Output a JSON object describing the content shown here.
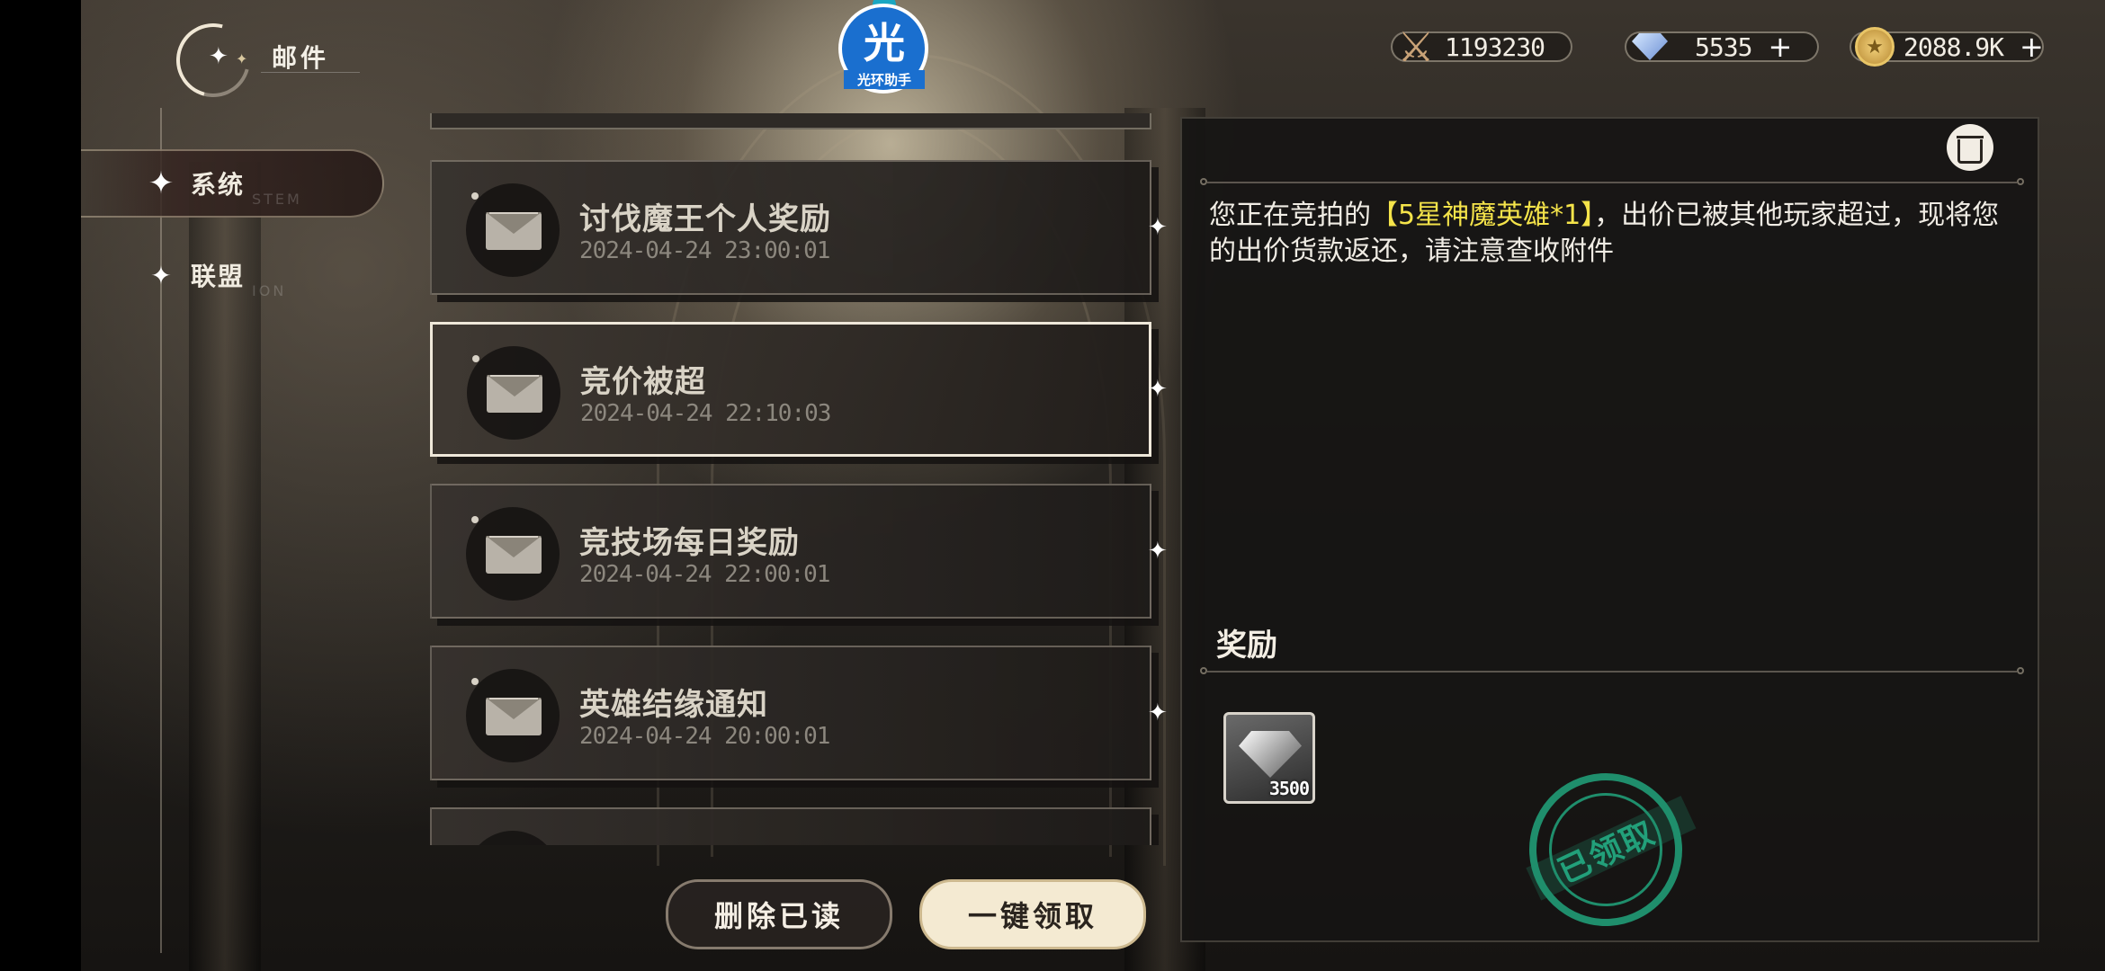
{
  "header": {
    "title": "邮件"
  },
  "badge": {
    "glyph": "光",
    "caption": "光环助手"
  },
  "currencies": [
    {
      "icon": "crossed-swords-icon",
      "value": "1193230",
      "has_plus": false
    },
    {
      "icon": "diamond-icon",
      "value": "5535",
      "has_plus": true
    },
    {
      "icon": "gold-coin-icon",
      "value": "2088.9K",
      "has_plus": true
    }
  ],
  "plus_symbol": "+",
  "sidebar": {
    "items": [
      {
        "label": "系统",
        "ghost": "STEM",
        "active": true
      },
      {
        "label": "联盟",
        "ghost": "ION",
        "active": false
      }
    ]
  },
  "mail_list": [
    {
      "title": "讨伐魔王个人奖励",
      "date": "2024-04-24 23:00:01",
      "selected": false
    },
    {
      "title": "竞价被超",
      "date": "2024-04-24 22:10:03",
      "selected": true
    },
    {
      "title": "竞技场每日奖励",
      "date": "2024-04-24 22:00:01",
      "selected": false
    },
    {
      "title": "英雄结缘通知",
      "date": "2024-04-24 20:00:01",
      "selected": false
    }
  ],
  "buttons": {
    "delete_read": "删除已读",
    "claim_all": "一键领取"
  },
  "detail": {
    "message_prefix": "您正在竞拍的",
    "message_highlight": "【5星神魔英雄*1】",
    "message_suffix": "，出价已被其他玩家超过，现将您的出价货款返还，请注意查收附件",
    "reward_heading": "奖励",
    "reward_items": [
      {
        "icon": "diamond-icon",
        "quantity": "3500"
      }
    ],
    "claimed_stamp": "已领取"
  },
  "colors": {
    "highlight": "#f5e44a",
    "stamp": "#1f8e6c",
    "selected_border": "#efe8da"
  }
}
